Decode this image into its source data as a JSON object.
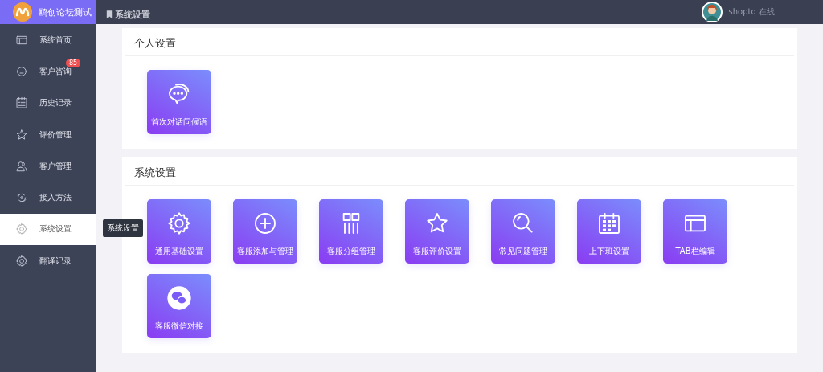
{
  "brand": {
    "name": "鸥创论坛测试"
  },
  "sidebar": {
    "items": [
      {
        "label": "系统首页",
        "selected": false
      },
      {
        "label": "客户咨询",
        "selected": false,
        "badge": "85"
      },
      {
        "label": "历史记录",
        "selected": false
      },
      {
        "label": "评价管理",
        "selected": false
      },
      {
        "label": "客户管理",
        "selected": false
      },
      {
        "label": "接入方法",
        "selected": false
      },
      {
        "label": "系统设置",
        "selected": true
      },
      {
        "label": "翻译记录",
        "selected": false
      }
    ]
  },
  "tooltip": "系统设置",
  "topbar": {
    "title": "系统设置",
    "user": "shoptq 在线"
  },
  "sections": [
    {
      "title": "个人设置",
      "tiles": [
        {
          "label": "首次对话问候语"
        }
      ]
    },
    {
      "title": "系统设置",
      "tiles": [
        {
          "label": "通用基础设置"
        },
        {
          "label": "客服添加与管理"
        },
        {
          "label": "客服分组管理"
        },
        {
          "label": "客服评价设置"
        },
        {
          "label": "常见问题管理"
        },
        {
          "label": "上下班设置"
        },
        {
          "label": "TAB栏编辑"
        },
        {
          "label": "客服微信对接"
        }
      ]
    }
  ]
}
